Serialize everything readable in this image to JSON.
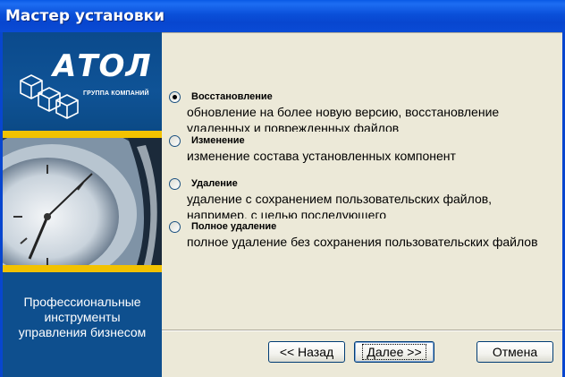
{
  "window": {
    "title": "Мастер установки"
  },
  "sidebar": {
    "logo_text": "АТОЛ",
    "logo_subtitle": "ГРУППА КОМПАНИЙ",
    "caption_lines": [
      "Профессиональные",
      "инструменты",
      "управления бизнесом"
    ]
  },
  "options": [
    {
      "title": "Восстановление",
      "description": "обновление на более новую версию, восстановление удаленных и поврежденных файлов",
      "selected": true
    },
    {
      "title": "Изменение",
      "description": "изменение состава установленных компонент",
      "selected": false
    },
    {
      "title": "Удаление",
      "description": "удаление с сохранением пользовательских файлов, например, с целью последующего",
      "selected": false
    },
    {
      "title": "Полное удаление",
      "description": "полное удаление без сохранения пользовательских файлов",
      "selected": false
    }
  ],
  "buttons": {
    "back": "<< Назад",
    "next": "Далее >>",
    "cancel": "Отмена"
  },
  "colors": {
    "titlebar": "#0a4fd9",
    "sidebar": "#0e4f8e",
    "stripe": "#f2c200",
    "dialog_bg": "#ece9d8"
  }
}
